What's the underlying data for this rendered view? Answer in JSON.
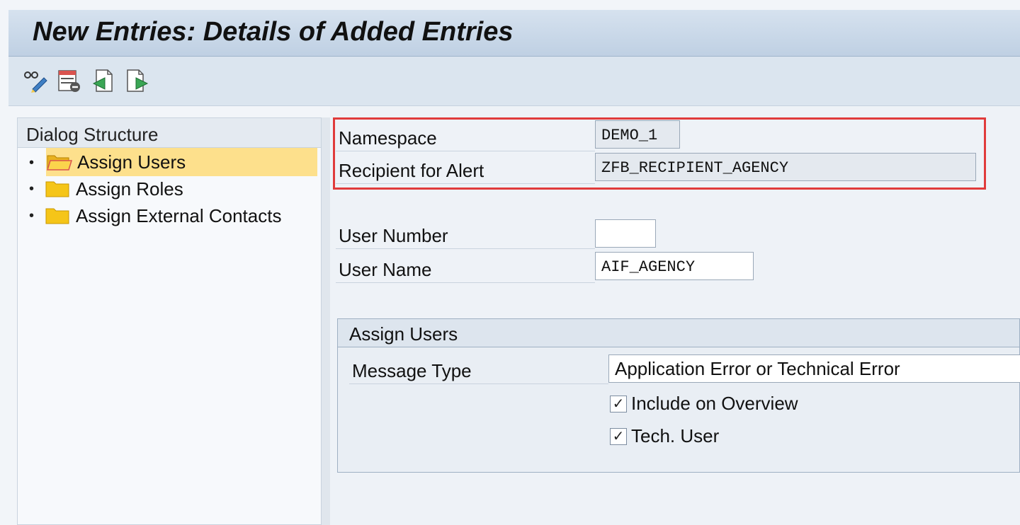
{
  "window": {
    "title": "New Entries: Details of Added Entries"
  },
  "toolbar": {
    "buttons": [
      {
        "icon": "glasses-edit-icon"
      },
      {
        "icon": "delete-entry-icon"
      },
      {
        "icon": "previous-entry-icon"
      },
      {
        "icon": "next-entry-icon"
      }
    ]
  },
  "dialog_structure": {
    "title": "Dialog Structure",
    "items": [
      {
        "label": "Assign Users",
        "selected": true
      },
      {
        "label": "Assign Roles",
        "selected": false
      },
      {
        "label": "Assign External Contacts",
        "selected": false
      }
    ]
  },
  "key_fields": {
    "namespace": {
      "label": "Namespace",
      "value": "DEMO_1"
    },
    "recipient": {
      "label": "Recipient for Alert",
      "value": "ZFB_RECIPIENT_AGENCY"
    }
  },
  "user_fields": {
    "user_number": {
      "label": "User Number",
      "value": ""
    },
    "user_name": {
      "label": "User Name",
      "value": "AIF_AGENCY"
    }
  },
  "assign_users_group": {
    "title": "Assign Users",
    "message_type": {
      "label": "Message Type",
      "value": "Application Error or Technical Error"
    },
    "include_on_overview": {
      "label": "Include on Overview",
      "checked": true
    },
    "tech_user": {
      "label": "Tech. User",
      "checked": true
    }
  },
  "colors": {
    "highlight": "#e03b3b",
    "selection": "#fde08c",
    "folder": "#f5c518"
  }
}
